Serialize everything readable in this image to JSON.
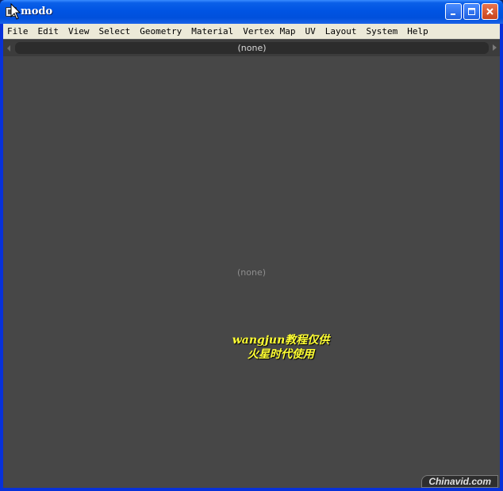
{
  "window": {
    "title": "modo"
  },
  "menubar": {
    "items": [
      "File",
      "Edit",
      "View",
      "Select",
      "Geometry",
      "Material",
      "Vertex Map",
      "UV",
      "Layout",
      "System",
      "Help"
    ]
  },
  "tabstrip": {
    "label": "(none)"
  },
  "viewport": {
    "label": "(none)"
  },
  "watermark": {
    "line1": "wangjun教程仅供",
    "line2": "火星时代使用",
    "color": "#ffff33"
  },
  "badge": {
    "text": "Chinavid.com"
  },
  "colors": {
    "titlebar": "#0054e3",
    "workspace": "#474747",
    "menubar": "#ece9d8"
  }
}
